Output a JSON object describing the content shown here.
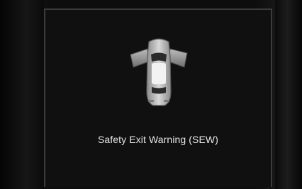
{
  "display": {
    "message": "Safety Exit Warning (SEW)",
    "icon": "car-open-doors-icon",
    "colors": {
      "background": "#000000",
      "panel": "#101010",
      "panel_border": "#3c3c3c",
      "text": "#e6e6e6"
    }
  }
}
